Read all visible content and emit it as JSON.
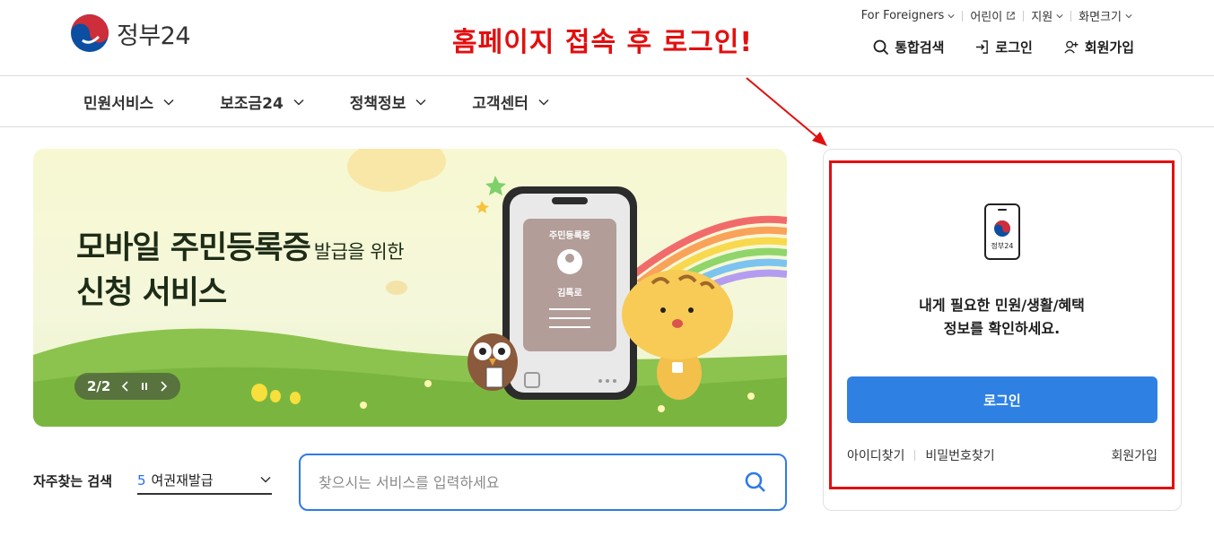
{
  "header": {
    "logo_text": "정부24",
    "util_links": [
      {
        "label": "For Foreigners",
        "icon": "chevron-down-icon"
      },
      {
        "label": "어린이",
        "icon": "external-link-icon"
      },
      {
        "label": "지원",
        "icon": "chevron-down-icon"
      },
      {
        "label": "화면크기",
        "icon": "chevron-down-icon"
      }
    ],
    "actions": {
      "search": "통합검색",
      "login": "로그인",
      "signup": "회원가입"
    }
  },
  "annotation": "홈페이지 접속 후 로그인!",
  "menu": [
    "민원서비스",
    "보조금24",
    "정책정보",
    "고객센터"
  ],
  "banner": {
    "title_line1": "모바일 주민등록증",
    "title_line1_suffix": "발급을 위한",
    "title_line2": "신청 서비스",
    "phone_card_title": "주민등록증",
    "phone_card_name": "김톡로",
    "pager": "2/2"
  },
  "search": {
    "fav_label": "자주찾는 검색",
    "fav_rank": "5",
    "fav_value": "여권재발급",
    "placeholder": "찾으시는 서비스를 입력하세요"
  },
  "login_card": {
    "icon_label": "정부24",
    "message_line1": "내게 필요한 민원/생활/혜택",
    "message_line2": "정보를 확인하세요.",
    "login_button": "로그인",
    "find_id": "아이디찾기",
    "find_pw": "비밀번호찾기",
    "signup": "회원가입"
  },
  "colors": {
    "accent_blue": "#2f80e3",
    "annotation_red": "#e20f0f"
  }
}
